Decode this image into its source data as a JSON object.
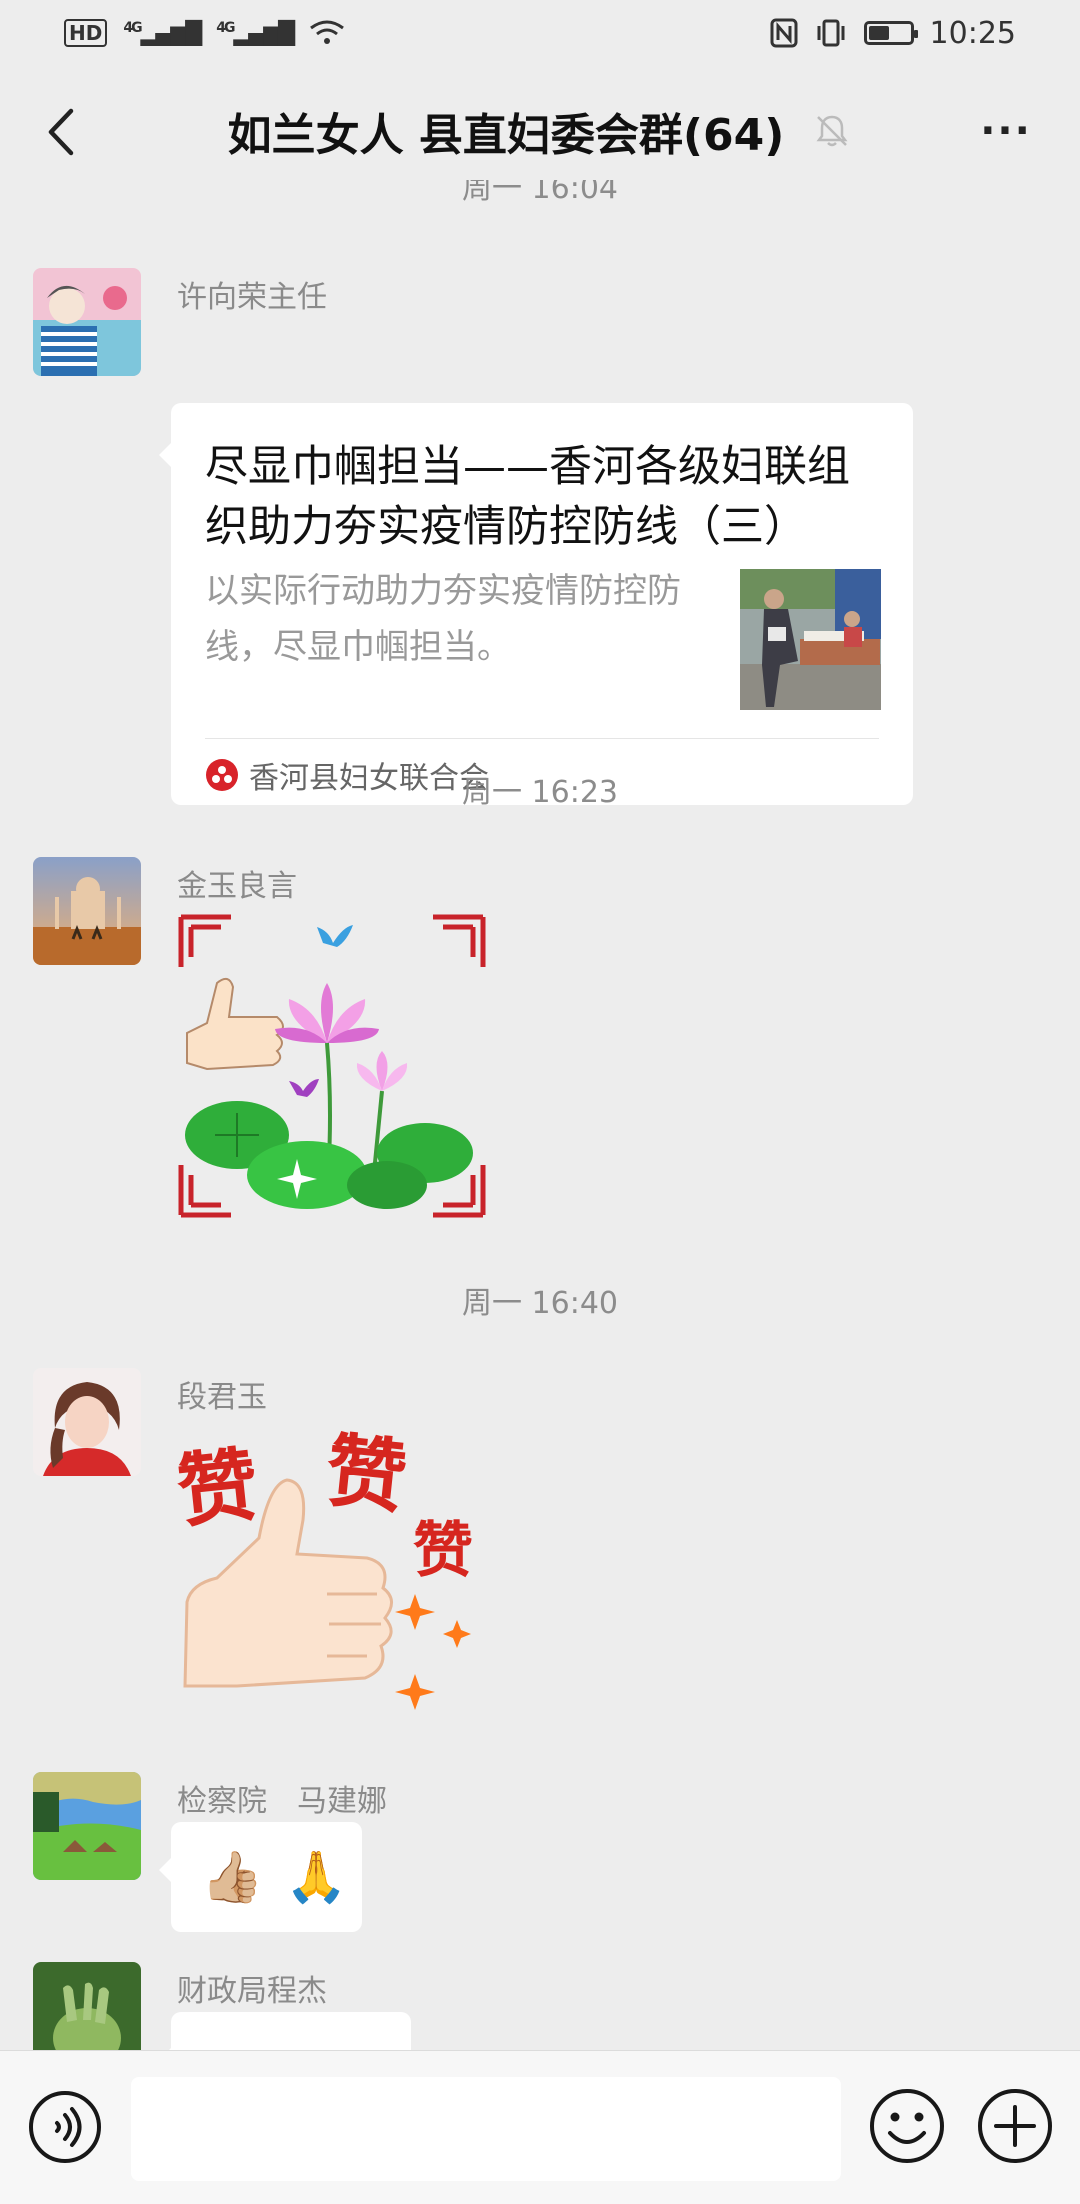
{
  "status_bar": {
    "hd_label": "HD",
    "network_1": "4G",
    "network_2": "4G",
    "time": "10:25",
    "battery_level": 0.55
  },
  "nav": {
    "title": "如兰女人 县直妇委会群(64)",
    "more_label": "···"
  },
  "chat": {
    "top_timestamp": "周一 16:04",
    "messages": [
      {
        "sender": "许向荣主任",
        "card": {
          "title": "尽显巾帼担当——香河各级妇联组织助力夯实疫情防控防线（三）",
          "description": "以实际行动助力夯实疫情防控防线，尽显巾帼担当。",
          "source": "香河县妇女联合会"
        }
      },
      {
        "timestamp": "周一 16:23"
      },
      {
        "sender": "金玉良言"
      },
      {
        "timestamp": "周一 16:40"
      },
      {
        "sender": "段君玉",
        "sticker_text": [
          "赞",
          "赞",
          "赞"
        ]
      },
      {
        "sender": "检察院　马建娜",
        "emojis": [
          "👍🏼",
          "🙏"
        ]
      },
      {
        "sender": "财政局程杰"
      }
    ]
  },
  "input_bar": {
    "placeholder": "",
    "icons": [
      "voice-icon",
      "emoji-icon",
      "plus-icon"
    ]
  }
}
